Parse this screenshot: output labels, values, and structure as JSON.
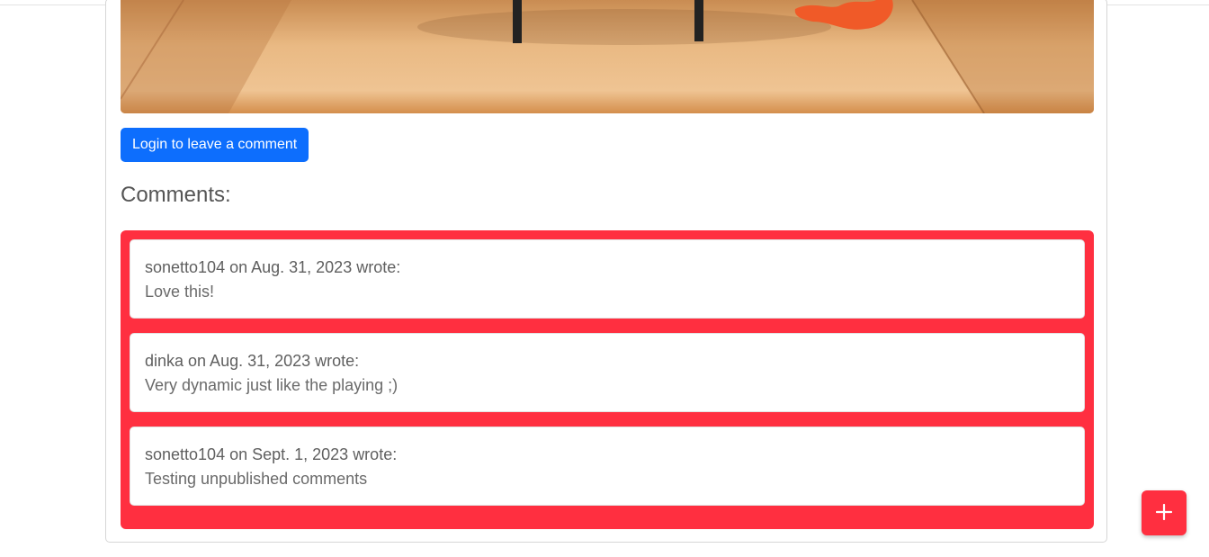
{
  "actions": {
    "login_label": "Login to leave a comment"
  },
  "comments": {
    "heading": "Comments:",
    "items": [
      {
        "meta": "sonetto104 on Aug. 31, 2023 wrote:",
        "body": "Love this!"
      },
      {
        "meta": "dinka on Aug. 31, 2023 wrote:",
        "body": "Very dynamic just like the playing ;)"
      },
      {
        "meta": "sonetto104 on Sept. 1, 2023 wrote:",
        "body": "Testing unpublished comments"
      }
    ]
  },
  "fab": {
    "icon": "plus-icon"
  },
  "colors": {
    "primary": "#0d6efd",
    "accent_red": "#ff2f40"
  }
}
